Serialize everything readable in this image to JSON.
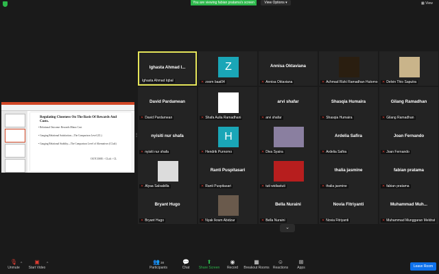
{
  "top": {
    "viewing": "You are viewing fabian pratama's screen",
    "view_options": "View Options ▾",
    "view": "View"
  },
  "slide": {
    "title": "Regulating Closeness On The Basis Of Rewards And Costs.",
    "bullets": [
      "• Relational Outcome: Rewards Minus Cost.",
      "• Gauging Relational Satisfaction—The Comparison Level (CL)",
      "• Gauging Relational Stability—The Comparison Level of Alternatives (CLalt)"
    ],
    "outcome": "OUTCOME > CLalt > CL"
  },
  "tiles": [
    {
      "name": "Ighasta Ahmad I...",
      "label": "Ighasta Ahmad Iqbal",
      "active": true
    },
    {
      "avatar": "Z",
      "label": "zoom baai04"
    },
    {
      "name": "Annisa Oktaviana",
      "label": "Annisa Oktaviana"
    },
    {
      "label": "Achmad Rizki Ramadhan Hutomo"
    },
    {
      "label": "Delvin Thio Saputra"
    },
    {
      "name": "David Pardamean",
      "label": "David Pardamean"
    },
    {
      "label": "Shafa Aulia Ramadhani"
    },
    {
      "name": "arvi shafar",
      "label": "arvi shafar"
    },
    {
      "name": "Shasqia Humaira",
      "label": "Shasqia Humaira"
    },
    {
      "name": "Gilang Ramadhan",
      "label": "Gilang Ramadhan"
    },
    {
      "name": "nyisiti nur shafa",
      "label": "nyisiti nur shafa"
    },
    {
      "avatar": "H",
      "label": "Hendrik Purnomo"
    },
    {
      "label": "Diva Syaira"
    },
    {
      "name": "Ardelia Safira",
      "label": "Ardelia Safira"
    },
    {
      "name": "Joan Fernando",
      "label": "Joan Fernando"
    },
    {
      "label": "Alyaa Salsabilla"
    },
    {
      "name": "Ranti Puspitasari",
      "label": "Ranti Puspitasari"
    },
    {
      "label": "tuti widiastuti"
    },
    {
      "name": "thalia jasmine",
      "label": "thalia jasmine"
    },
    {
      "name": "fabian pratama",
      "label": "fabian pratama"
    },
    {
      "name": "Bryant Hugo",
      "label": "Bryant Hugo"
    },
    {
      "label": "Nyak Ikram Abidzar"
    },
    {
      "name": "Bella Nuraini",
      "label": "Bella Nuraini"
    },
    {
      "name": "Novia Fitriyanti",
      "label": "Novia Fitriyanti"
    },
    {
      "name": "Muhammad Muh...",
      "label": "Muhammad Munggaran Meldrat"
    }
  ],
  "toolbar": {
    "unmute": "Unmute",
    "start_video": "Start Video",
    "participants": "Participants",
    "participants_count": "38",
    "chat": "Chat",
    "share_screen": "Share Screen",
    "record": "Record",
    "breakout_rooms": "Breakout Rooms",
    "reactions": "Reactions",
    "apps": "Apps",
    "leave": "Leave Room"
  }
}
